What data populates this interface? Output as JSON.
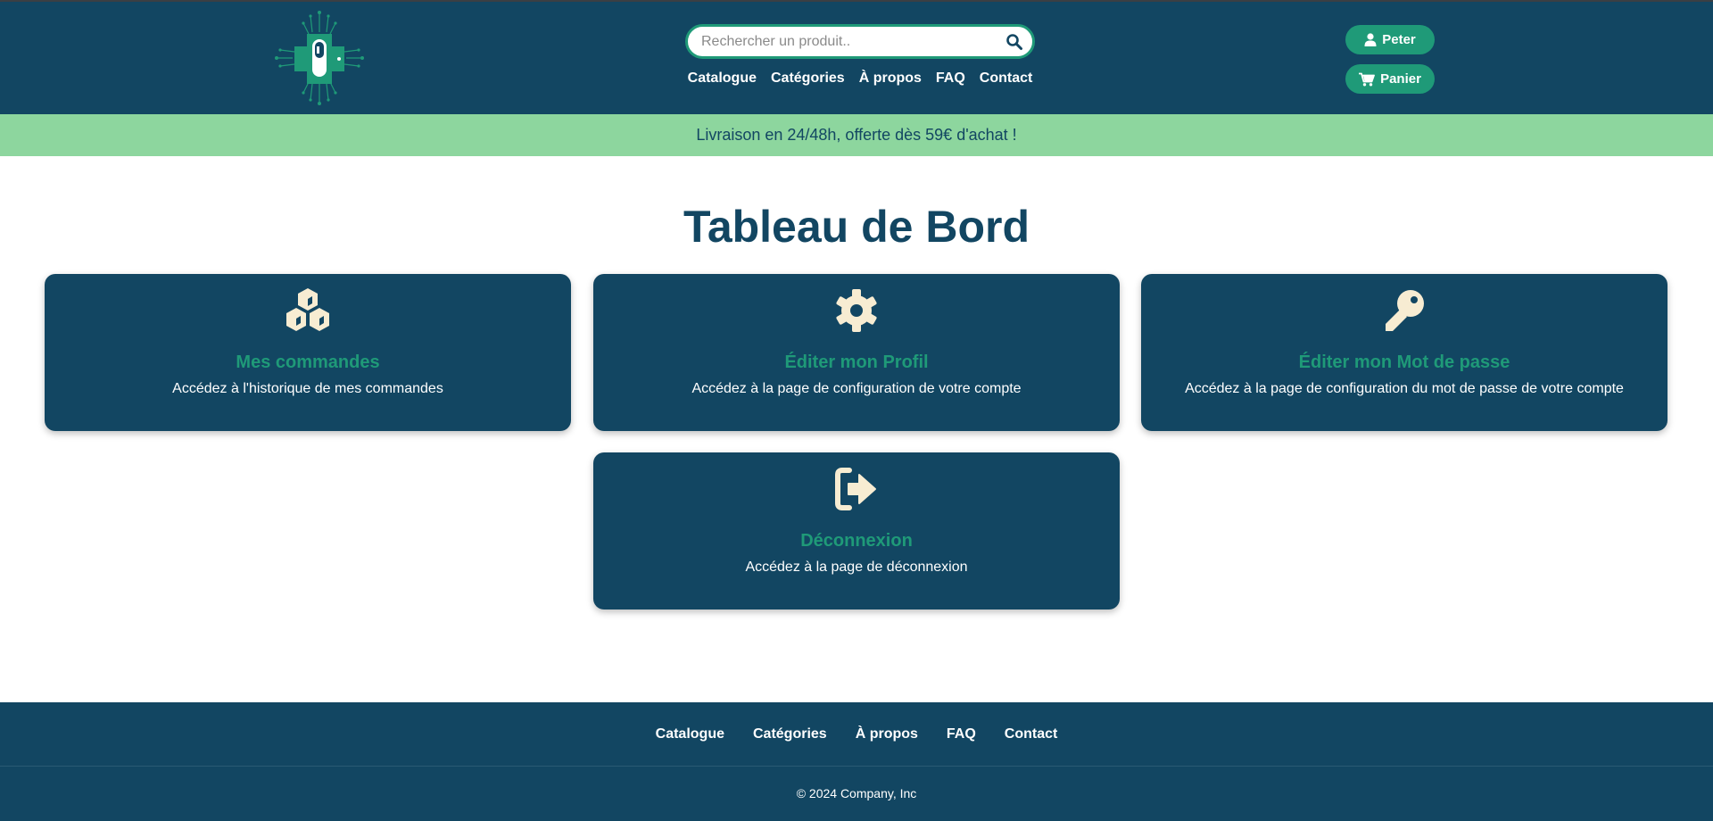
{
  "colors": {
    "header_bg": "#124662",
    "accent": "#1f9a78",
    "promo_bg": "#8dd69e",
    "icon_cream": "#f7ecd2"
  },
  "header": {
    "logo_icon": "pill-circuit-logo-icon",
    "search": {
      "placeholder": "Rechercher un produit..",
      "value": "",
      "icon": "search-icon"
    },
    "nav": [
      {
        "label": "Catalogue"
      },
      {
        "label": "Catégories"
      },
      {
        "label": "À propos"
      },
      {
        "label": "FAQ"
      },
      {
        "label": "Contact"
      }
    ],
    "user_button": {
      "label": "Peter",
      "icon": "user-icon"
    },
    "cart_button": {
      "label": "Panier",
      "icon": "cart-icon"
    }
  },
  "promo": {
    "text": "Livraison en 24/48h, offerte dès 59€ d'achat !"
  },
  "main": {
    "title": "Tableau de Bord",
    "cards": [
      {
        "title": "Mes commandes",
        "description": "Accédez à l'historique de mes commandes",
        "icon": "cubes-icon"
      },
      {
        "title": "Éditer mon Profil",
        "description": "Accédez à la page de configuration de votre compte",
        "icon": "gear-icon"
      },
      {
        "title": "Éditer mon Mot de passe",
        "description": "Accédez à la page de configuration du mot de passe de votre compte",
        "icon": "key-icon"
      },
      {
        "title": "Déconnexion",
        "description": "Accédez à la page de déconnexion",
        "icon": "logout-icon"
      }
    ]
  },
  "footer": {
    "nav": [
      {
        "label": "Catalogue"
      },
      {
        "label": "Catégories"
      },
      {
        "label": "À propos"
      },
      {
        "label": "FAQ"
      },
      {
        "label": "Contact"
      }
    ],
    "copyright": "© 2024 Company, Inc"
  }
}
